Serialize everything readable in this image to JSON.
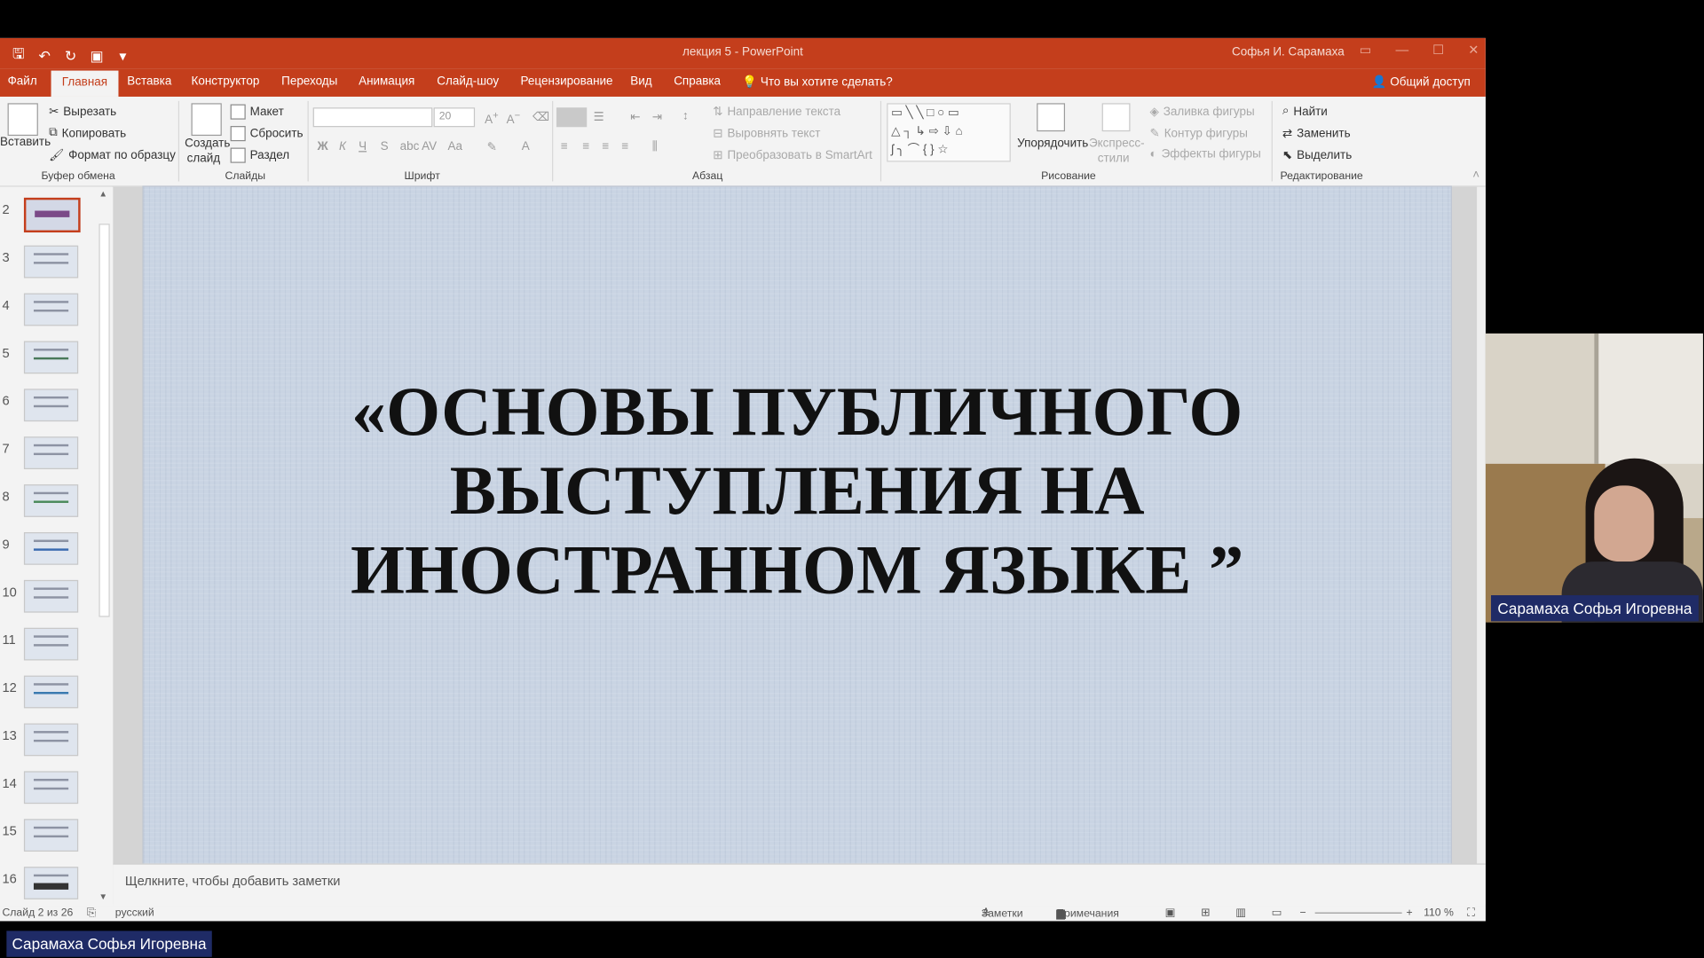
{
  "window": {
    "document_title": "лекция 5  -  PowerPoint",
    "user": "Софья И. Сарамаха",
    "qat_icons": [
      "save-icon",
      "undo-icon",
      "redo-icon",
      "present-icon",
      "customize-icon"
    ]
  },
  "tabs": [
    {
      "label": "Файл"
    },
    {
      "label": "Главная",
      "active": true
    },
    {
      "label": "Вставка"
    },
    {
      "label": "Конструктор"
    },
    {
      "label": "Переходы"
    },
    {
      "label": "Анимация"
    },
    {
      "label": "Слайд-шоу"
    },
    {
      "label": "Рецензирование"
    },
    {
      "label": "Вид"
    },
    {
      "label": "Справка"
    }
  ],
  "tell_me": "Что вы хотите сделать?",
  "share": "Общий доступ",
  "ribbon": {
    "clipboard": {
      "paste": "Вставить",
      "cut": "Вырезать",
      "copy": "Копировать",
      "format_painter": "Формат по образцу",
      "label": "Буфер обмена"
    },
    "slides": {
      "new_slide_1": "Создать",
      "new_slide_2": "слайд",
      "layout": "Макет",
      "reset": "Сбросить",
      "section": "Раздел",
      "label": "Слайды"
    },
    "font": {
      "size": "20",
      "bold": "Ж",
      "italic": "К",
      "underline": "Ч",
      "strike": "S",
      "label": "Шрифт"
    },
    "paragraph": {
      "text_direction": "Направление текста",
      "align_text": "Выровнять текст",
      "smartart": "Преобразовать в SmartArt",
      "label": "Абзац"
    },
    "drawing": {
      "arrange": "Упорядочить",
      "quick_styles_1": "Экспресс-",
      "quick_styles_2": "стили",
      "shape_fill": "Заливка фигуры",
      "shape_outline": "Контур фигуры",
      "shape_effects": "Эффекты фигуры",
      "label": "Рисование"
    },
    "editing": {
      "find": "Найти",
      "replace": "Заменить",
      "select": "Выделить",
      "label": "Редактирование"
    }
  },
  "thumbnails": [
    {
      "num": "2",
      "active": true
    },
    {
      "num": "3"
    },
    {
      "num": "4"
    },
    {
      "num": "5"
    },
    {
      "num": "6"
    },
    {
      "num": "7"
    },
    {
      "num": "8"
    },
    {
      "num": "9"
    },
    {
      "num": "10"
    },
    {
      "num": "11"
    },
    {
      "num": "12"
    },
    {
      "num": "13"
    },
    {
      "num": "14"
    },
    {
      "num": "15"
    },
    {
      "num": "16"
    }
  ],
  "slide": {
    "title": "«ОСНОВЫ ПУБЛИЧНОГО\nВЫСТУПЛЕНИЯ НА\nИНОСТРАННОМ ЯЗЫКЕ ”"
  },
  "notes_placeholder": "Щелкните, чтобы добавить заметки",
  "status": {
    "slide_counter": "Слайд 2 из 26",
    "language": "русский",
    "notes": "Заметки",
    "comments": "Примечания",
    "zoom": "110 %"
  },
  "participant": {
    "name": "Сарамаха Софья Игоревна"
  },
  "presenter": {
    "name": "Сарамаха Софья Игоревна"
  }
}
